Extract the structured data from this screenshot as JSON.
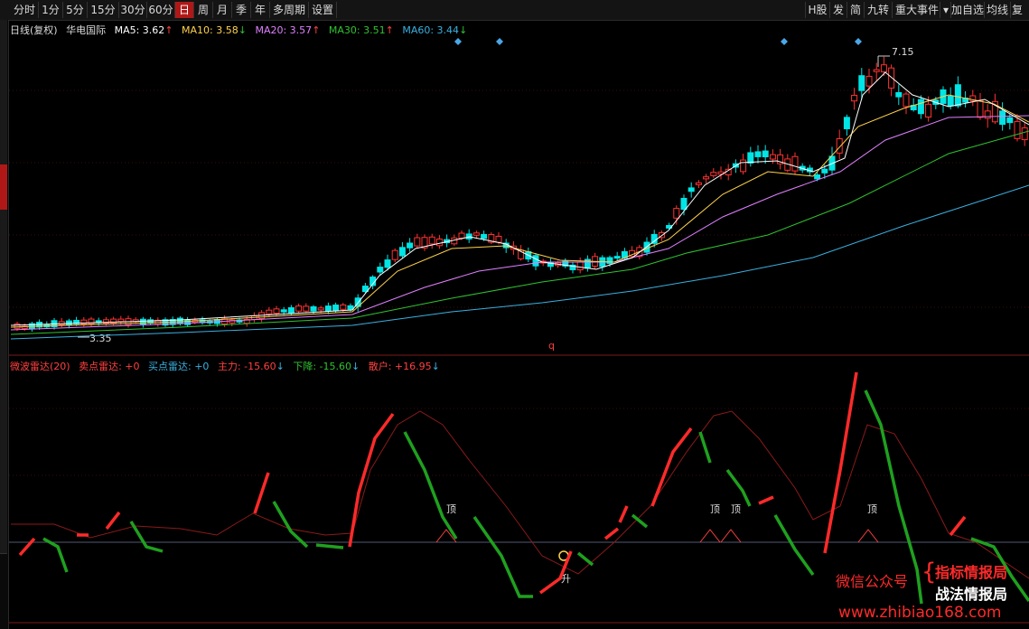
{
  "toolbar": {
    "left": [
      {
        "label": "分时",
        "active": false
      },
      {
        "label": "1分",
        "active": false
      },
      {
        "label": "5分",
        "active": false
      },
      {
        "label": "15分",
        "active": false
      },
      {
        "label": "30分",
        "active": false
      },
      {
        "label": "60分",
        "active": false
      },
      {
        "label": "日",
        "active": true
      },
      {
        "label": "周",
        "active": false
      },
      {
        "label": "月",
        "active": false
      },
      {
        "label": "季",
        "active": false
      },
      {
        "label": "年",
        "active": false
      },
      {
        "label": "多周期",
        "active": false
      },
      {
        "label": "设置",
        "active": false
      }
    ],
    "right": [
      "H股",
      "发",
      "简",
      "九转",
      "重大事件",
      "加自选",
      "均线",
      "复"
    ]
  },
  "main_info": {
    "period": "日线(复权)",
    "stock": "华电国际",
    "ma5": {
      "label": "MA5: 3.62",
      "arrow": "↑",
      "color": "#ffffff"
    },
    "ma10": {
      "label": "MA10: 3.58",
      "arrow": "↓",
      "color": "#ffd24a"
    },
    "ma20": {
      "label": "MA20: 3.57",
      "arrow": "↑",
      "color": "#e080ff"
    },
    "ma30": {
      "label": "MA30: 3.51",
      "arrow": "↑",
      "color": "#2fc22f"
    },
    "ma60": {
      "label": "MA60: 3.44",
      "arrow": "↓",
      "color": "#3ab0e0"
    }
  },
  "price_labels": {
    "high": "7.15",
    "low": "3.35",
    "marker": "q"
  },
  "indicator_info": {
    "name": "微波雷达(20)",
    "sell": "卖点雷达: +0",
    "buy": "买点雷达: +0",
    "main": "主力: -15.60",
    "main_arrow": "↓",
    "down": "下降: -15.60",
    "down_arrow": "↓",
    "retail": "散户: +16.95",
    "retail_arrow": "↓"
  },
  "signals": {
    "top": "顶",
    "rise": "升"
  },
  "watermark": {
    "wechat": "微信公众号",
    "brand1": "指标情报局",
    "brand2": "战法情报局",
    "site": "www.zhibiao168.com"
  },
  "colors": {
    "up": "#ff3232",
    "down": "#00e5e5",
    "accent": "#b01818"
  }
}
